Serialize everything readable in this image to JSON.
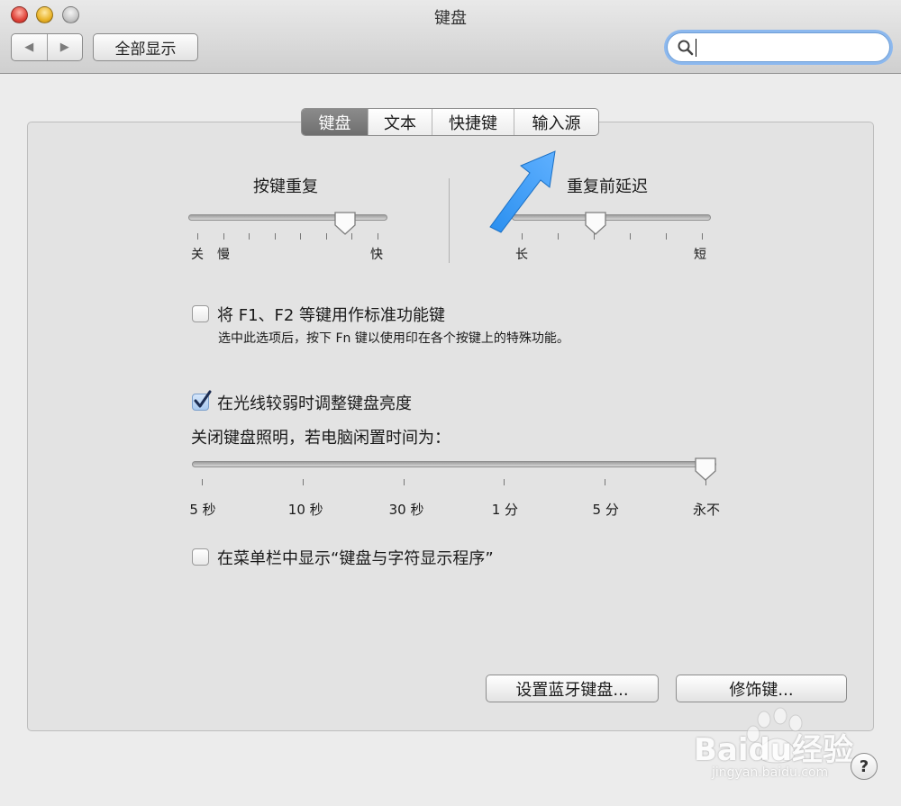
{
  "window": {
    "title": "键盘"
  },
  "toolbar": {
    "back_icon": "◀",
    "forward_icon": "▶",
    "show_all_label": "全部显示",
    "search": {
      "value": "",
      "placeholder": ""
    }
  },
  "tabs": [
    {
      "label": "键盘",
      "active": true
    },
    {
      "label": "文本",
      "active": false
    },
    {
      "label": "快捷键",
      "active": false
    },
    {
      "label": "输入源",
      "active": false
    }
  ],
  "key_repeat": {
    "title": "按键重复",
    "min_label": "关",
    "slow_label": "慢",
    "max_label": "快",
    "level": 0.82
  },
  "delay_until_repeat": {
    "title": "重复前延迟",
    "min_label": "长",
    "max_label": "短",
    "level": 0.41
  },
  "fn_keys": {
    "checked": false,
    "label": "将 F1、F2 等键用作标准功能键",
    "description": "选中此选项后，按下 Fn 键以使用印在各个按键上的特殊功能。"
  },
  "backlight": {
    "checked": true,
    "label": "在光线较弱时调整键盘亮度",
    "off_label": "关闭键盘照明，若电脑闲置时间为：",
    "tick_labels": [
      "5 秒",
      "10 秒",
      "30 秒",
      "1 分",
      "5 分",
      "永不"
    ],
    "selected": "永不"
  },
  "menubar_viewer": {
    "checked": false,
    "label": "在菜单栏中显示“键盘与字符显示程序”"
  },
  "buttons": {
    "bluetooth_label": "设置蓝牙键盘...",
    "modifier_label": "修饰键..."
  },
  "help_label": "?",
  "watermark": {
    "brand": "Baidu经验",
    "url": "jingyan.baidu.com"
  },
  "colors": {
    "arrow": "#1f86e8",
    "checkmark": "#1c2d52",
    "search_focus": "#8cb8ee"
  }
}
